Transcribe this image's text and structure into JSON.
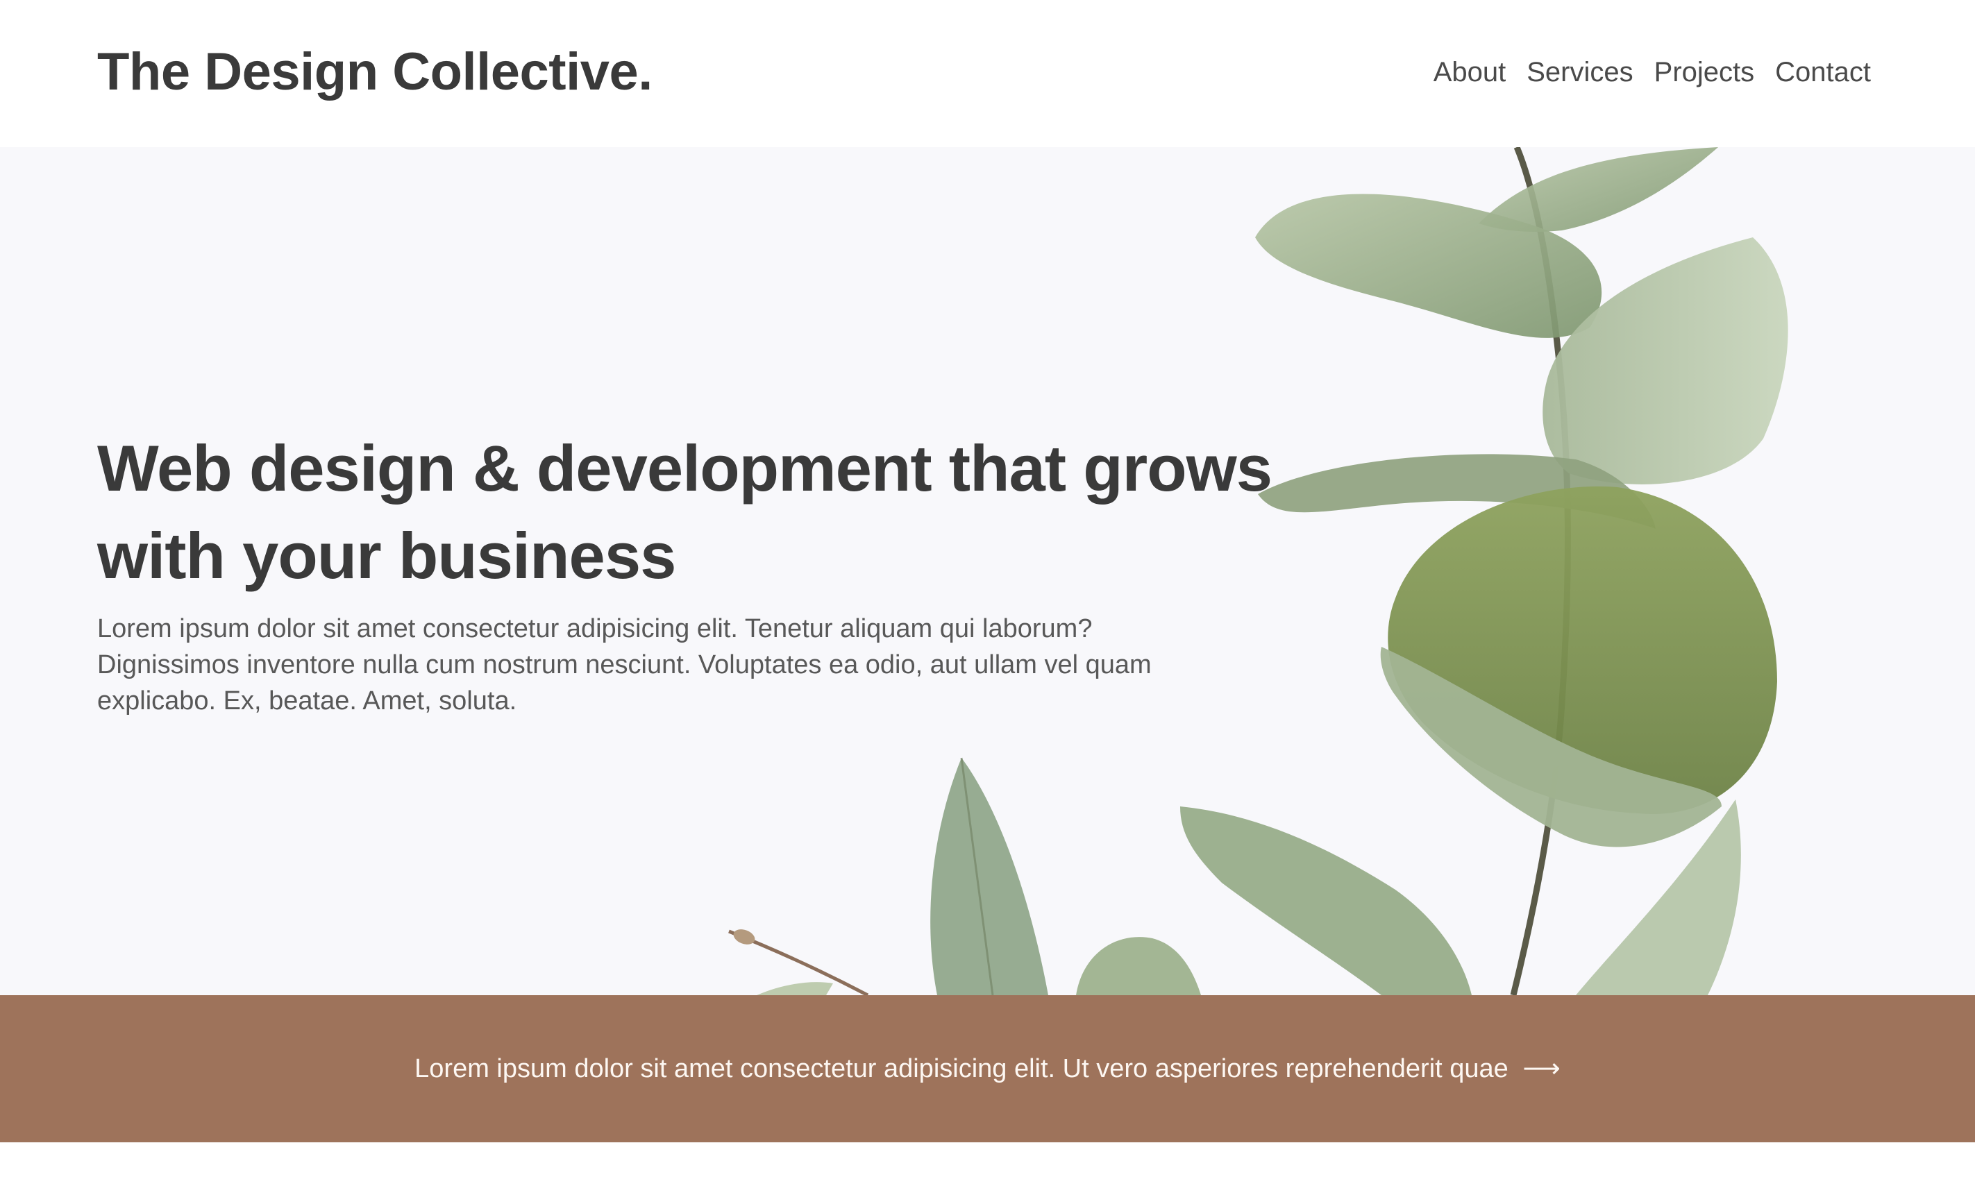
{
  "header": {
    "logo": "The Design Collective.",
    "nav": [
      "About",
      "Services",
      "Projects",
      "Contact"
    ]
  },
  "hero": {
    "title": "Web design & development that grows with your business",
    "body": "Lorem ipsum dolor sit amet consectetur adipisicing elit. Tenetur aliquam qui laborum? Dignissimos inventore nulla cum nostrum nesciunt. Voluptates ea odio, aut ullam vel quam explicabo. Ex, beatae. Amet, soluta.",
    "image_icon": "eucalyptus-leaves-photo"
  },
  "banner": {
    "text": "Lorem ipsum dolor sit amet consectetur adipisicing elit. Ut vero asperiores reprehenderit quae",
    "arrow": "⟶"
  },
  "colors": {
    "hero_bg": "#f8f8fb",
    "banner_bg": "#9e735b",
    "text": "#3a3a3a"
  }
}
